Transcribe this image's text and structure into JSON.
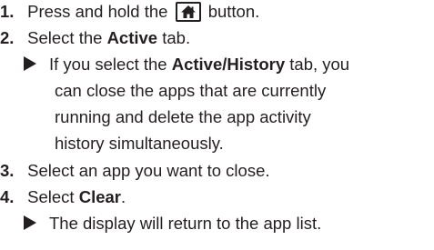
{
  "steps": [
    {
      "number": "1.",
      "text_before": "Press and hold the",
      "icon": "home-icon",
      "text_after": "button."
    },
    {
      "number": "2.",
      "text_before": "Select the",
      "bold": "Active",
      "text_after": "tab.",
      "note": {
        "line1_before": "If you select the",
        "line1_bold": "Active/History",
        "line1_after": "tab, you",
        "line2": "can close the apps that are currently",
        "line3": "running and delete the app activity",
        "line4": "history simultaneously."
      }
    },
    {
      "number": "3.",
      "text": "Select an app you want to close."
    },
    {
      "number": "4.",
      "text_before": "Select",
      "bold": "Clear",
      "text_after": ".",
      "note": {
        "line1": "The display will return to the app list."
      }
    }
  ]
}
